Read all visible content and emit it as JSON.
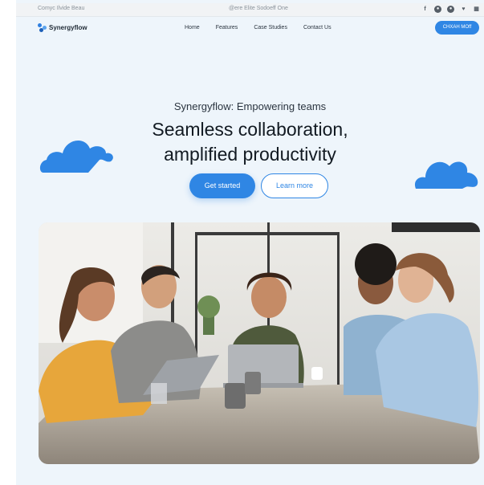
{
  "topbar": {
    "left_text": "Comyc Ilvide Beau",
    "center_text": "@ere Elite Sodoeff One",
    "social_icons": [
      "facebook-icon",
      "circle-icon",
      "circle-icon",
      "twitter-icon",
      "linkedin-icon"
    ]
  },
  "nav": {
    "logo": "Synergyflow",
    "links": [
      "Home",
      "Features",
      "Case Studies",
      "Contact Us"
    ],
    "cta": "CHXAH MOff"
  },
  "hero": {
    "eyebrow": "Synergyflow: Empowering teams",
    "headline_line1": "Seamless collaboration,",
    "headline_line2": "amplified productivity",
    "primary_button": "Get started",
    "secondary_button": "Learn more"
  },
  "colors": {
    "accent": "#2f86e4",
    "background": "#eef5fb",
    "text": "#121a22"
  }
}
